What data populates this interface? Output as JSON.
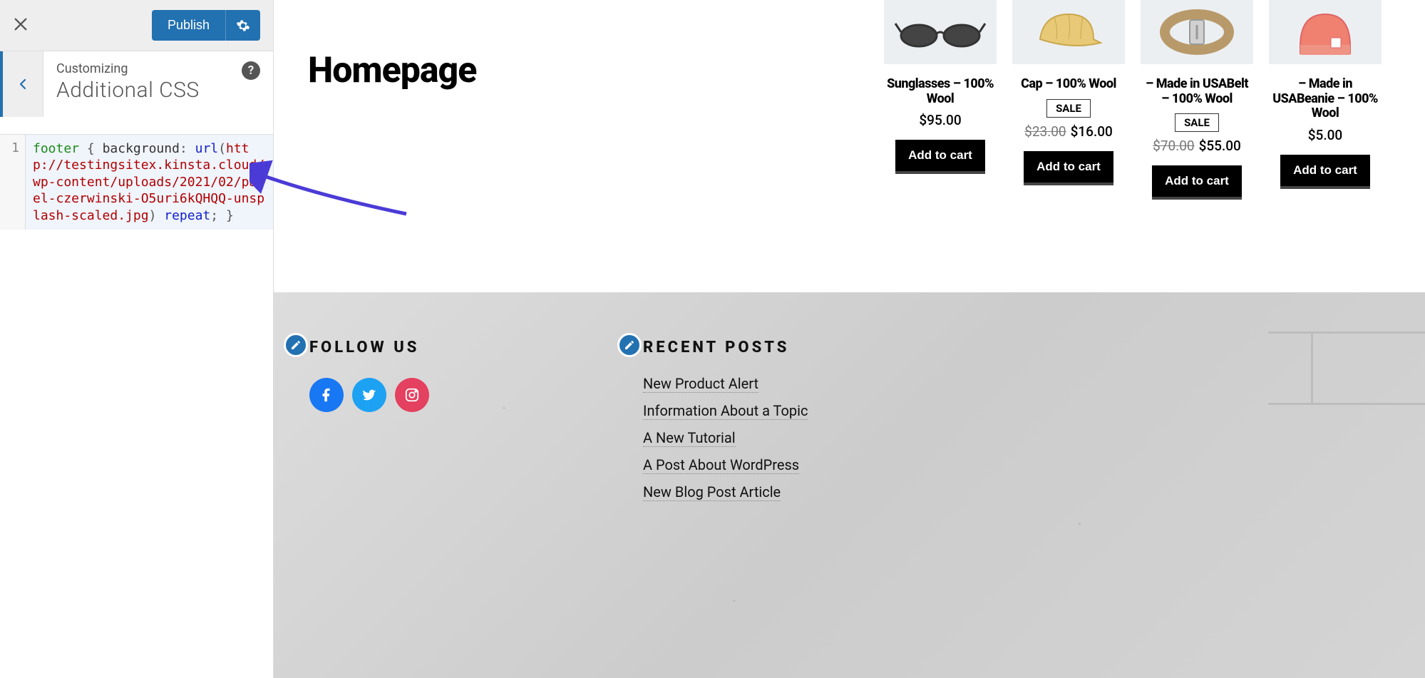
{
  "sidebar": {
    "publish_label": "Publish",
    "crumb": "Customizing",
    "title": "Additional CSS",
    "line_number": "1"
  },
  "css_tokens": {
    "selector": "footer",
    "prop": "background",
    "kw_url": "url",
    "url_value": "http://testingsitex.kinsta.cloud/wp-content/uploads/2021/02/pawel-czerwinski-O5uri6kQHQQ-unsplash-scaled.jpg",
    "kw_repeat": "repeat"
  },
  "page": {
    "title": "Homepage"
  },
  "products": [
    {
      "name": "Sunglasses – 100% Wool",
      "price": "$95.00",
      "old": "",
      "sale": false,
      "btn": "Add to cart",
      "icon": "sunglasses"
    },
    {
      "name": "Cap – 100% Wool",
      "price": "$16.00",
      "old": "$23.00",
      "sale": true,
      "btn": "Add to cart",
      "icon": "cap"
    },
    {
      "name": "– Made in USABelt – 100% Wool",
      "price": "$55.00",
      "old": "$70.00",
      "sale": true,
      "btn": "Add to cart",
      "icon": "belt"
    },
    {
      "name": "– Made in USABeanie – 100% Wool",
      "price": "$5.00",
      "old": "",
      "sale": false,
      "btn": "Add to cart",
      "icon": "beanie"
    }
  ],
  "sale_label": "SALE",
  "footer": {
    "follow_title": "FOLLOW US",
    "recent_title": "RECENT POSTS",
    "posts": [
      "New Product Alert",
      "Information About a Topic",
      "A New Tutorial",
      "A Post About WordPress",
      "New Blog Post Article"
    ]
  }
}
